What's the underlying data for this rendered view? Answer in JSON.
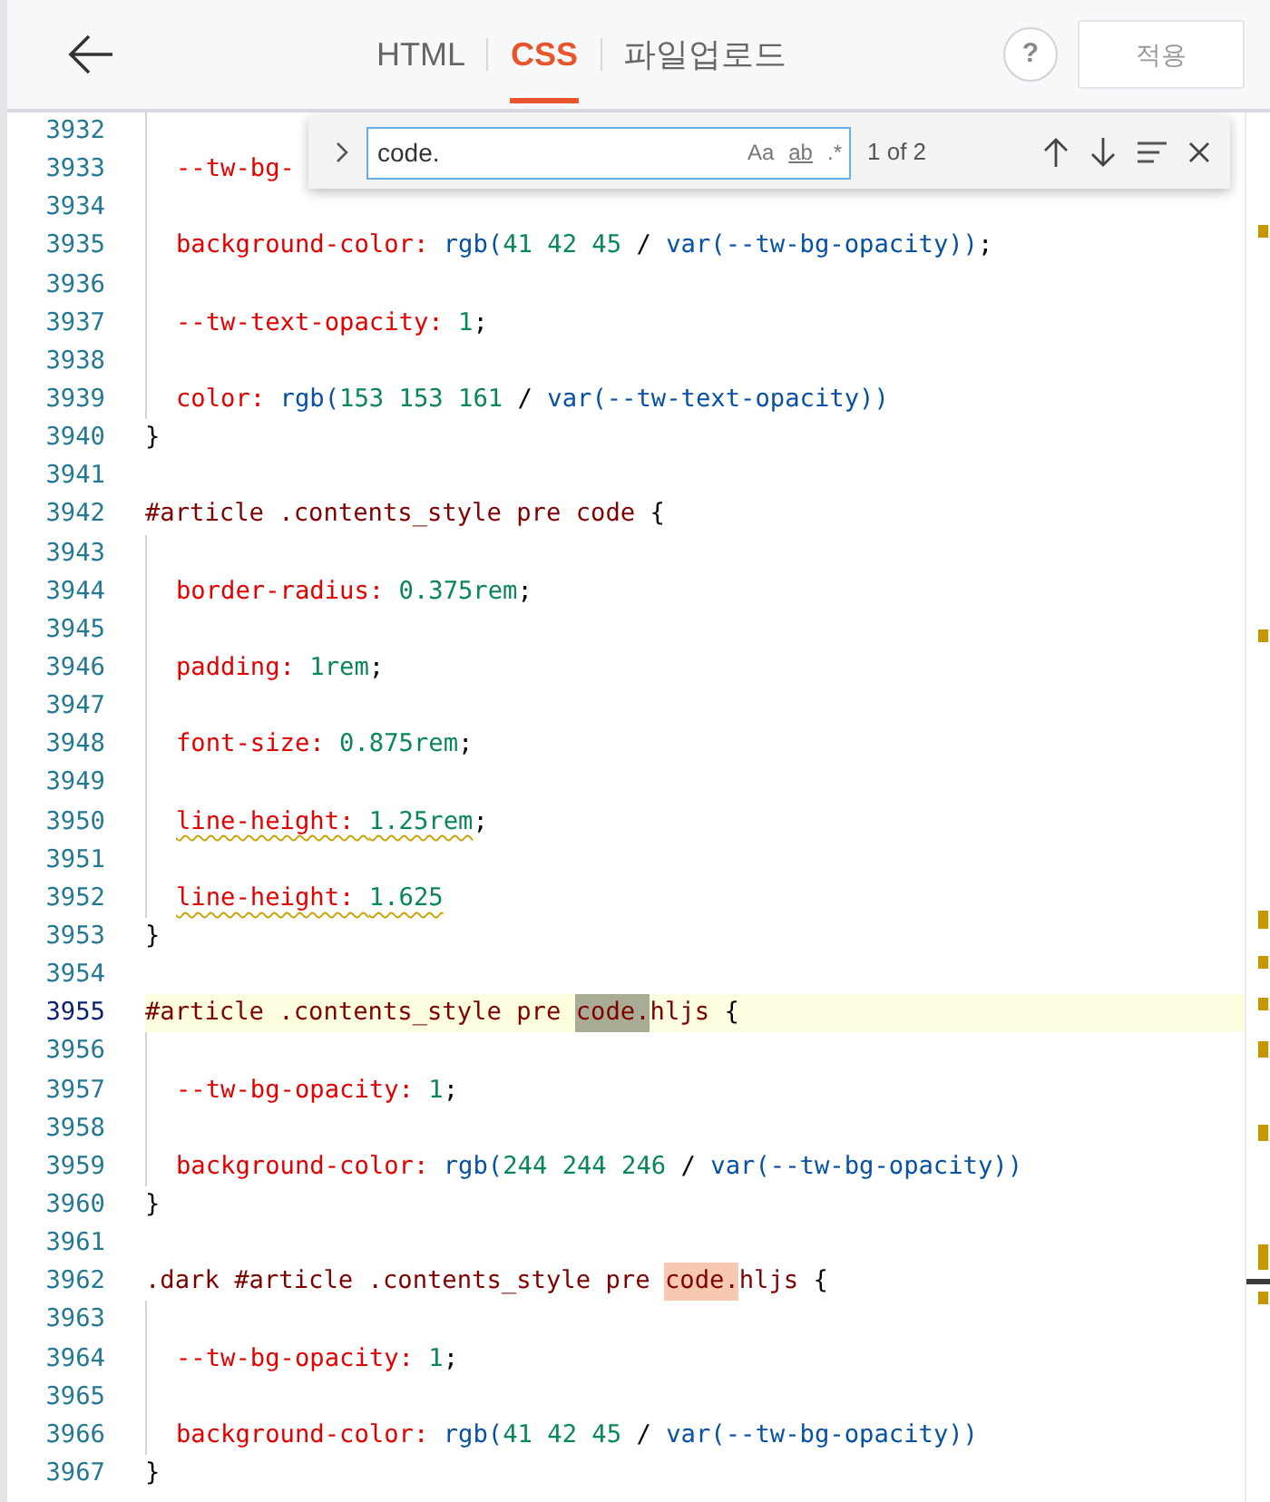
{
  "header": {
    "tabs": [
      {
        "label": "HTML",
        "selected": false
      },
      {
        "label": "CSS",
        "selected": true
      },
      {
        "label": "파일업로드",
        "selected": false
      }
    ],
    "help": "?",
    "apply_button": {
      "label": "적용",
      "disabled": true
    }
  },
  "find_widget": {
    "value": "code.",
    "options": [
      "Aa",
      "ab",
      ".*"
    ],
    "count": "1 of 2"
  },
  "editor": {
    "lines": [
      {
        "number": "3932",
        "indent": true
      },
      {
        "number": "3933",
        "indent": true,
        "tokens": [
          {
            "t": "--tw-bg-",
            "kind": "prop"
          }
        ]
      },
      {
        "number": "3934",
        "indent": true
      },
      {
        "number": "3935",
        "indent": true,
        "tokens": [
          {
            "t": "background-color: ",
            "kind": "prop"
          },
          {
            "t": "rgb(",
            "kind": "fn"
          },
          {
            "t": "41 42 45",
            "kind": "num"
          },
          {
            "t": " / ",
            "kind": "punct"
          },
          {
            "t": "var(--tw-bg-opacity))",
            "kind": "fn"
          },
          {
            "t": ";",
            "kind": "punct"
          }
        ]
      },
      {
        "number": "3936",
        "indent": true
      },
      {
        "number": "3937",
        "indent": true,
        "tokens": [
          {
            "t": "--tw-text-opacity: ",
            "kind": "prop"
          },
          {
            "t": "1",
            "kind": "num"
          },
          {
            "t": ";",
            "kind": "punct"
          }
        ]
      },
      {
        "number": "3938",
        "indent": true
      },
      {
        "number": "3939",
        "indent": true,
        "tokens": [
          {
            "t": "color: ",
            "kind": "prop"
          },
          {
            "t": "rgb(",
            "kind": "fn"
          },
          {
            "t": "153 153 161",
            "kind": "num"
          },
          {
            "t": " / ",
            "kind": "punct"
          },
          {
            "t": "var(--tw-text-opacity))",
            "kind": "fn"
          }
        ]
      },
      {
        "number": "3940",
        "indent": false,
        "tokens": [
          {
            "t": "}",
            "kind": "punct"
          }
        ]
      },
      {
        "number": "3941",
        "indent": false
      },
      {
        "number": "3942",
        "indent": false,
        "tokens": [
          {
            "t": "#article .contents_style pre code ",
            "kind": "sel"
          },
          {
            "t": "{",
            "kind": "punct"
          }
        ]
      },
      {
        "number": "3943",
        "indent": true
      },
      {
        "number": "3944",
        "indent": true,
        "tokens": [
          {
            "t": "border-radius: ",
            "kind": "prop"
          },
          {
            "t": "0.375rem",
            "kind": "num"
          },
          {
            "t": ";",
            "kind": "punct"
          }
        ]
      },
      {
        "number": "3945",
        "indent": true
      },
      {
        "number": "3946",
        "indent": true,
        "tokens": [
          {
            "t": "padding: ",
            "kind": "prop"
          },
          {
            "t": "1rem",
            "kind": "num"
          },
          {
            "t": ";",
            "kind": "punct"
          }
        ]
      },
      {
        "number": "3947",
        "indent": true
      },
      {
        "number": "3948",
        "indent": true,
        "tokens": [
          {
            "t": "font-size: ",
            "kind": "prop"
          },
          {
            "t": "0.875rem",
            "kind": "num"
          },
          {
            "t": ";",
            "kind": "punct"
          }
        ]
      },
      {
        "number": "3949",
        "indent": true
      },
      {
        "number": "3950",
        "indent": true,
        "tokens": [
          {
            "t": "line-height: ",
            "kind": "prop",
            "warn": true
          },
          {
            "t": "1.25rem",
            "kind": "num",
            "warn": true
          },
          {
            "t": ";",
            "kind": "punct"
          }
        ]
      },
      {
        "number": "3951",
        "indent": true
      },
      {
        "number": "3952",
        "indent": true,
        "tokens": [
          {
            "t": "line-height: ",
            "kind": "prop",
            "warn": true
          },
          {
            "t": "1.625",
            "kind": "num",
            "warn": true
          }
        ]
      },
      {
        "number": "3953",
        "indent": false,
        "tokens": [
          {
            "t": "}",
            "kind": "punct"
          }
        ]
      },
      {
        "number": "3954",
        "indent": false
      },
      {
        "number": "3955",
        "indent": false,
        "current": true,
        "tokens": [
          {
            "t": "#article .contents_style pre ",
            "kind": "sel"
          },
          {
            "t": "code.",
            "kind": "sel",
            "match": true,
            "current_match": true
          },
          {
            "t": "hljs ",
            "kind": "sel"
          },
          {
            "t": "{",
            "kind": "punct"
          }
        ]
      },
      {
        "number": "3956",
        "indent": true
      },
      {
        "number": "3957",
        "indent": true,
        "tokens": [
          {
            "t": "--tw-bg-opacity: ",
            "kind": "prop"
          },
          {
            "t": "1",
            "kind": "num"
          },
          {
            "t": ";",
            "kind": "punct"
          }
        ]
      },
      {
        "number": "3958",
        "indent": true
      },
      {
        "number": "3959",
        "indent": true,
        "tokens": [
          {
            "t": "background-color: ",
            "kind": "prop"
          },
          {
            "t": "rgb(",
            "kind": "fn"
          },
          {
            "t": "244 244 246",
            "kind": "num"
          },
          {
            "t": " / ",
            "kind": "punct"
          },
          {
            "t": "var(--tw-bg-opacity))",
            "kind": "fn"
          }
        ]
      },
      {
        "number": "3960",
        "indent": false,
        "tokens": [
          {
            "t": "}",
            "kind": "punct"
          }
        ]
      },
      {
        "number": "3961",
        "indent": false
      },
      {
        "number": "3962",
        "indent": false,
        "tokens": [
          {
            "t": ".dark #article .contents_style pre ",
            "kind": "sel"
          },
          {
            "t": "code.",
            "kind": "sel",
            "match": true,
            "current_match": false
          },
          {
            "t": "hljs ",
            "kind": "sel"
          },
          {
            "t": "{",
            "kind": "punct"
          }
        ]
      },
      {
        "number": "3963",
        "indent": true
      },
      {
        "number": "3964",
        "indent": true,
        "tokens": [
          {
            "t": "--tw-bg-opacity: ",
            "kind": "prop"
          },
          {
            "t": "1",
            "kind": "num"
          },
          {
            "t": ";",
            "kind": "punct"
          }
        ]
      },
      {
        "number": "3965",
        "indent": true
      },
      {
        "number": "3966",
        "indent": true,
        "tokens": [
          {
            "t": "background-color: ",
            "kind": "prop"
          },
          {
            "t": "rgb(",
            "kind": "fn"
          },
          {
            "t": "41 42 45",
            "kind": "num"
          },
          {
            "t": " / ",
            "kind": "punct"
          },
          {
            "t": "var(--tw-bg-opacity))",
            "kind": "fn"
          }
        ]
      },
      {
        "number": "3967",
        "indent": false,
        "tokens": [
          {
            "t": "}",
            "kind": "punct"
          }
        ]
      }
    ]
  }
}
